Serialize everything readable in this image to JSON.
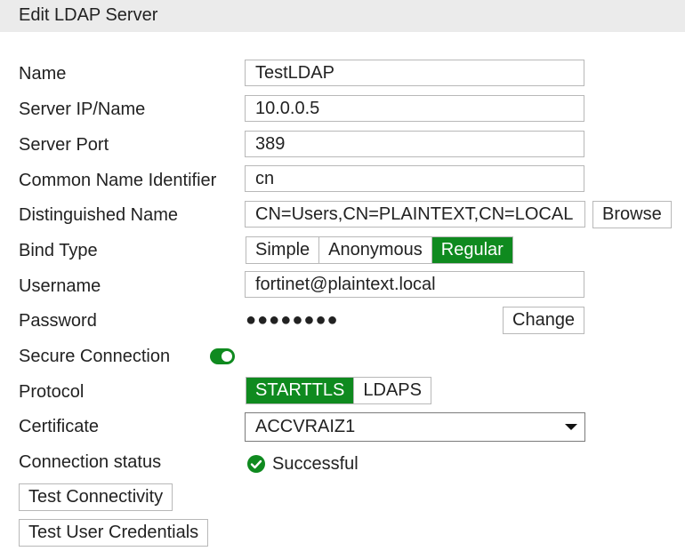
{
  "header": {
    "title": "Edit LDAP Server"
  },
  "form": {
    "name": {
      "label": "Name",
      "value": "TestLDAP"
    },
    "server_ip": {
      "label": "Server IP/Name",
      "value": "10.0.0.5"
    },
    "server_port": {
      "label": "Server Port",
      "value": "389"
    },
    "cn_identifier": {
      "label": "Common Name Identifier",
      "value": "cn"
    },
    "distinguished_name": {
      "label": "Distinguished Name",
      "value": "CN=Users,CN=PLAINTEXT,CN=LOCAL",
      "browse_label": "Browse"
    },
    "bind_type": {
      "label": "Bind Type",
      "options": [
        "Simple",
        "Anonymous",
        "Regular"
      ],
      "selected": "Regular"
    },
    "username": {
      "label": "Username",
      "value": "fortinet@plaintext.local"
    },
    "password": {
      "label": "Password",
      "masked": "●●●●●●●●",
      "change_label": "Change"
    },
    "secure_connection": {
      "label": "Secure Connection",
      "enabled": true
    },
    "protocol": {
      "label": "Protocol",
      "options": [
        "STARTTLS",
        "LDAPS"
      ],
      "selected": "STARTTLS"
    },
    "certificate": {
      "label": "Certificate",
      "value": "ACCVRAIZ1"
    },
    "connection_status": {
      "label": "Connection status",
      "value": "Successful"
    }
  },
  "actions": {
    "test_connectivity": "Test Connectivity",
    "test_user_credentials": "Test User Credentials"
  },
  "colors": {
    "accent": "#0f8a1f",
    "header_bg": "#ebebeb",
    "border": "#b8b8b8"
  },
  "icons": {
    "status": "check-circle-icon",
    "dropdown": "caret-down-icon"
  }
}
